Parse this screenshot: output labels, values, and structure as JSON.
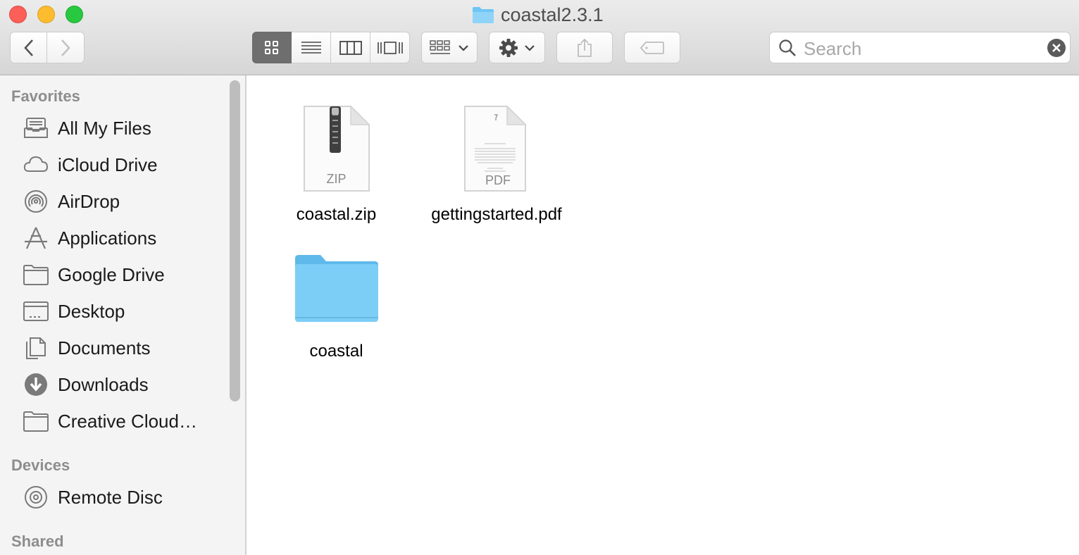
{
  "window": {
    "title": "coastal2.3.1"
  },
  "toolbar": {
    "back_icon": "chevron-left-icon",
    "forward_icon": "chevron-right-icon",
    "view_modes": [
      "icon-view-icon",
      "list-view-icon",
      "column-view-icon",
      "cover-flow-icon"
    ],
    "selected_view": "icon",
    "arrange_icon": "arrange-grid-icon",
    "action_icon": "gear-icon",
    "share_icon": "share-icon",
    "tag_icon": "tag-icon"
  },
  "search": {
    "placeholder": "Search",
    "value": ""
  },
  "sidebar": {
    "sections": [
      {
        "label": "Favorites"
      },
      {
        "label": "Devices"
      },
      {
        "label": "Shared"
      }
    ],
    "favorites": [
      {
        "label": "All My Files",
        "icon": "all-files-icon"
      },
      {
        "label": "iCloud Drive",
        "icon": "cloud-icon"
      },
      {
        "label": "AirDrop",
        "icon": "airdrop-icon"
      },
      {
        "label": "Applications",
        "icon": "applications-icon"
      },
      {
        "label": "Google Drive",
        "icon": "folder-icon"
      },
      {
        "label": "Desktop",
        "icon": "desktop-icon"
      },
      {
        "label": "Documents",
        "icon": "documents-icon"
      },
      {
        "label": "Downloads",
        "icon": "download-icon"
      },
      {
        "label": "Creative Cloud…",
        "icon": "folder-icon"
      }
    ],
    "devices": [
      {
        "label": "Remote Disc",
        "icon": "disc-icon"
      }
    ]
  },
  "files": [
    {
      "name": "coastal.zip",
      "kind": "ZIP",
      "icon": "zip-file-icon"
    },
    {
      "name": "gettingstarted.pdf",
      "kind": "PDF",
      "icon": "pdf-file-icon"
    },
    {
      "name": "coastal",
      "kind": "folder",
      "icon": "folder-icon"
    }
  ],
  "colors": {
    "close": "#fc5f57",
    "minimize": "#fdbc2e",
    "maximize": "#28c940",
    "folder": "#6dc6f5",
    "sidebar_bg": "#f4f4f5"
  }
}
